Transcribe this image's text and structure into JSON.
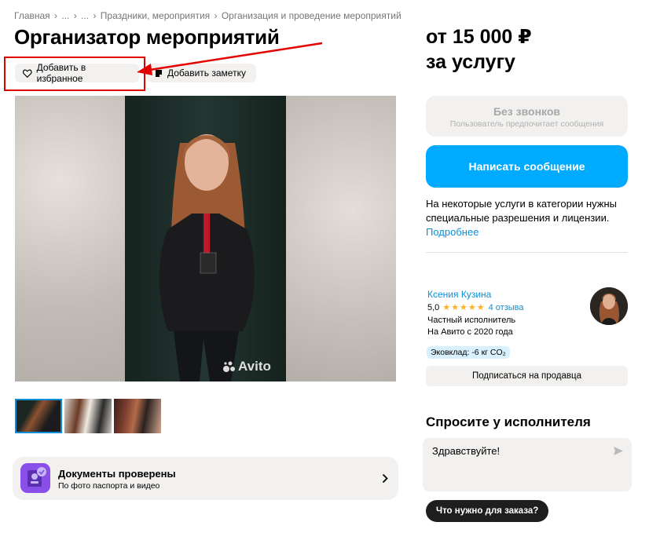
{
  "breadcrumbs": [
    "Главная",
    "...",
    "...",
    "Праздники, мероприятия",
    "Организация и проведение мероприятий"
  ],
  "breadcrumb_separator": "›",
  "title": "Организатор мероприятий",
  "actions": {
    "favorite": "Добавить в избранное",
    "note": "Добавить заметку"
  },
  "gallery": {
    "watermark": "Avito",
    "thumbnail_count": 3
  },
  "documents": {
    "title": "Документы проверены",
    "subtitle": "По фото паспорта и видео"
  },
  "price": {
    "line1": "от 15 000 ₽",
    "line2": "за услугу"
  },
  "no_calls": {
    "title": "Без звонков",
    "subtitle": "Пользователь предпочитает сообщения"
  },
  "message_button": "Написать сообщение",
  "license_info": {
    "text": "На некоторые услуги в категории нужны специальные разрешения и лицензии.",
    "link": "Подробнее"
  },
  "seller": {
    "name": "Ксения Кузина",
    "rating": "5,0",
    "stars": "★★★★★",
    "reviews": "4 отзыва",
    "type": "Частный исполнитель",
    "since": "На Авито с 2020 года",
    "eco": "Эковклад: -6 кг CO₂",
    "subscribe": "Подписаться на продавца"
  },
  "ask": {
    "title": "Спросите у исполнителя",
    "message": "Здравствуйте!",
    "chip": "Что нужно для заказа?"
  },
  "colors": {
    "accent": "#00aaff",
    "annotation": "#e50000",
    "link": "#0a8fd8",
    "star": "#ffb021"
  }
}
